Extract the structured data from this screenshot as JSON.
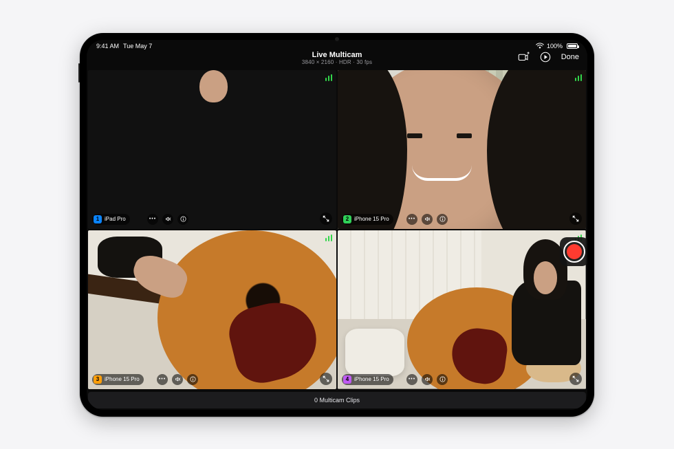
{
  "status": {
    "time": "9:41 AM",
    "date": "Tue May 7",
    "battery_pct": "100%"
  },
  "header": {
    "title": "Live Multicam",
    "subtitle": "3840 × 2160 · HDR · 30 fps",
    "done": "Done"
  },
  "feeds": [
    {
      "index": "1",
      "label": "iPad Pro",
      "badge_color": "#0a84ff"
    },
    {
      "index": "2",
      "label": "iPhone 15 Pro",
      "badge_color": "#30d158"
    },
    {
      "index": "3",
      "label": "iPhone 15 Pro",
      "badge_color": "#ff9f0a"
    },
    {
      "index": "4",
      "label": "iPhone 15 Pro",
      "badge_color": "#bf5af2"
    }
  ],
  "footer": {
    "clips": "0 Multicam Clips"
  },
  "colors": {
    "record": "#ff3b30",
    "signal": "#32d74b"
  }
}
